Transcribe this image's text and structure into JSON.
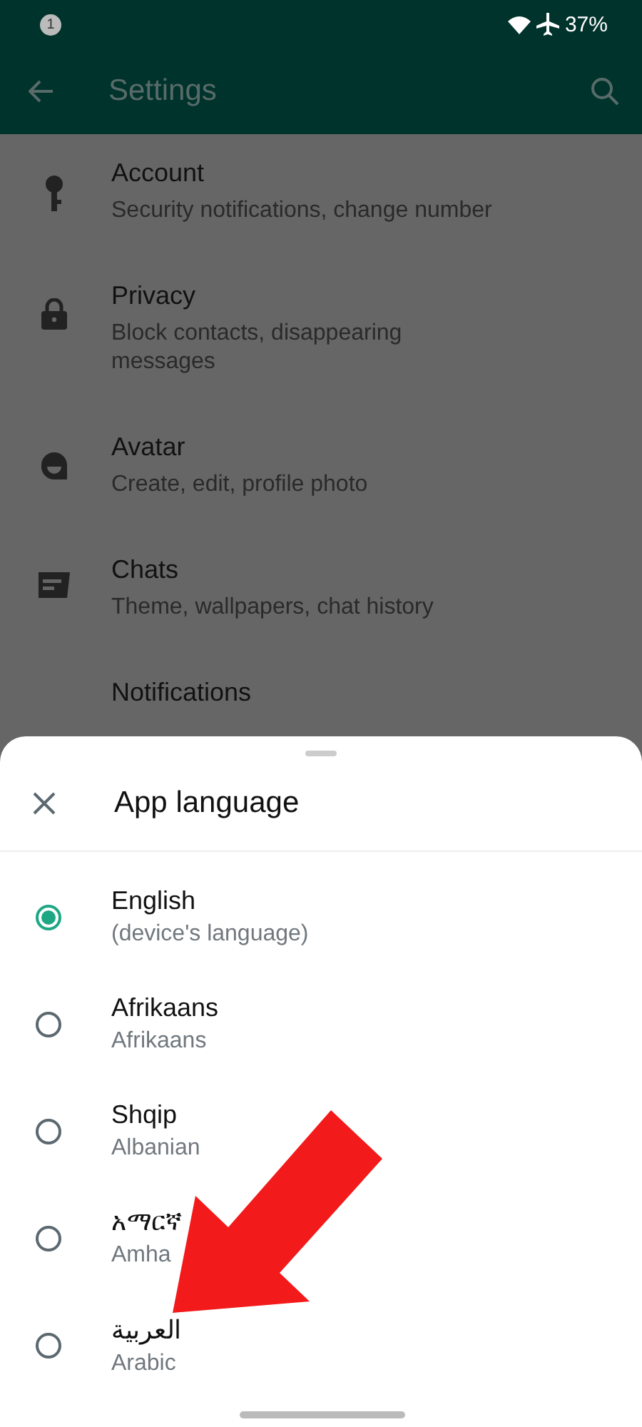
{
  "status_bar": {
    "notification_count": "1",
    "battery": "37%"
  },
  "app_bar": {
    "title": "Settings"
  },
  "settings": [
    {
      "kind": "key",
      "title": "Account",
      "subtitle": "Security notifications, change number"
    },
    {
      "kind": "lock",
      "title": "Privacy",
      "subtitle": "Block contacts, disappearing messages"
    },
    {
      "kind": "avatar",
      "title": "Avatar",
      "subtitle": "Create, edit, profile photo"
    },
    {
      "kind": "chat",
      "title": "Chats",
      "subtitle": "Theme, wallpapers, chat history"
    },
    {
      "title": "Notifications"
    }
  ],
  "sheet": {
    "title": "App language",
    "languages": [
      {
        "name": "English",
        "subtitle": "(device's language)",
        "selected": true
      },
      {
        "name": "Afrikaans",
        "subtitle": "Afrikaans",
        "selected": false
      },
      {
        "name": "Shqip",
        "subtitle": "Albanian",
        "selected": false
      },
      {
        "name": "አማርኛ",
        "subtitle": "Amha",
        "selected": false
      },
      {
        "name": "العربية",
        "subtitle": "Arabic",
        "selected": false
      }
    ]
  }
}
